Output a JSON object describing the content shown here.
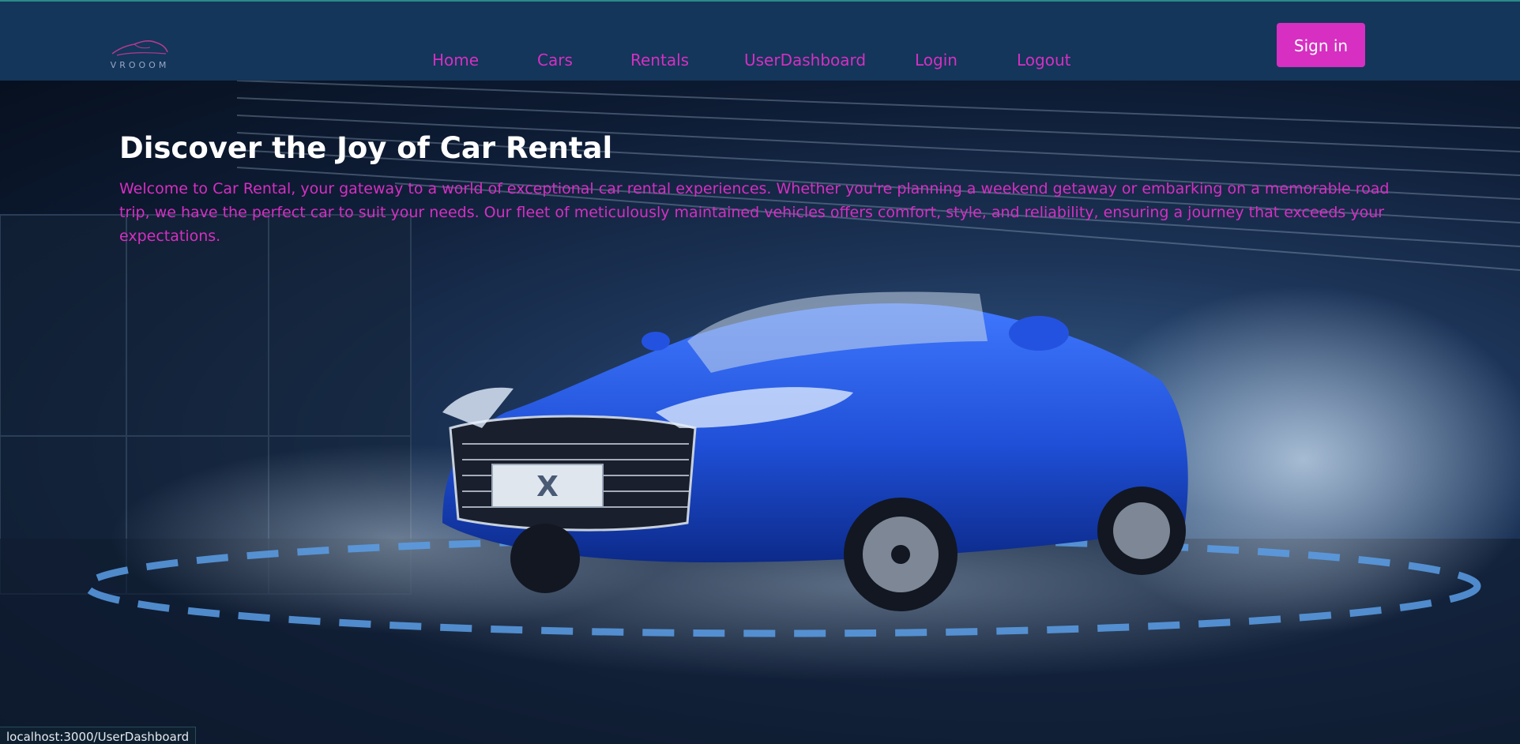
{
  "brand": {
    "logo_text": "VROOOM"
  },
  "nav": {
    "items": [
      {
        "label": "Home"
      },
      {
        "label": "Cars"
      },
      {
        "label": "Rentals"
      },
      {
        "label": "UserDashboard"
      },
      {
        "label": "Login"
      },
      {
        "label": "Logout"
      }
    ],
    "signin_label": "Sign in"
  },
  "hero": {
    "title": "Discover the Joy of Car Rental",
    "description": "Welcome to Car Rental, your gateway to a world of exceptional car rental experiences. Whether you're planning a weekend getaway or embarking on a memorable road trip, we have the perfect car to suit your needs. Our fleet of meticulously maintained vehicles offers comfort, style, and reliability, ensuring a journey that exceeds your expectations.",
    "image_badge": "X"
  },
  "status_bar": {
    "url": "localhost:3000/UserDashboard"
  },
  "colors": {
    "accent": "#d62fc2",
    "navbar": "#13365a",
    "title": "#ffffff",
    "car": "#1f4fd6"
  }
}
